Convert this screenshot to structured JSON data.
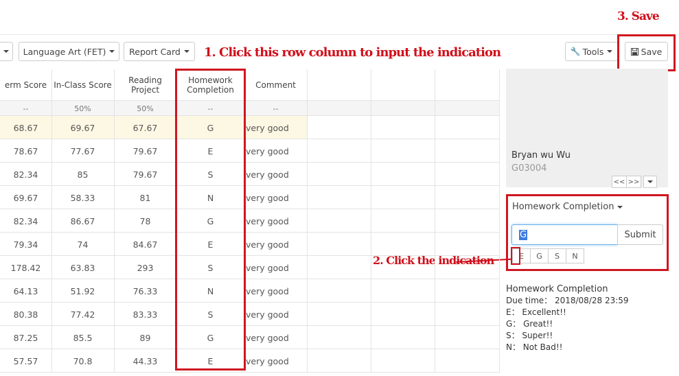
{
  "toolbar": {
    "prev_dropdown_label": "",
    "subject_label": "Language Art (FET)",
    "report_label": "Report Card",
    "tools_label": "Tools",
    "save_label": "Save"
  },
  "annotations": {
    "step1": "1. Click this row column to input the indication",
    "step2": "2. Click  the indication",
    "step3": "3. Save"
  },
  "table": {
    "headers": [
      "erm Score",
      "In-Class Score",
      "Reading Project",
      "Homework\nCompletion",
      "Comment",
      "",
      "",
      ""
    ],
    "weights": [
      "--",
      "50%",
      "50%",
      "--",
      "--",
      "",
      "",
      ""
    ],
    "rows": [
      [
        "68.67",
        "69.67",
        "67.67",
        "G",
        "very good"
      ],
      [
        "78.67",
        "77.67",
        "79.67",
        "E",
        "very good"
      ],
      [
        "82.34",
        "85",
        "79.67",
        "S",
        "very good"
      ],
      [
        "69.67",
        "58.33",
        "81",
        "N",
        "very good"
      ],
      [
        "82.34",
        "86.67",
        "78",
        "G",
        "very good"
      ],
      [
        "79.34",
        "74",
        "84.67",
        "E",
        "very good"
      ],
      [
        "178.42",
        "63.83",
        "293",
        "S",
        "very good"
      ],
      [
        "64.13",
        "51.92",
        "76.33",
        "N",
        "very good"
      ],
      [
        "80.38",
        "77.42",
        "83.33",
        "S",
        "very good"
      ],
      [
        "87.25",
        "85.5",
        "89",
        "G",
        "very good"
      ],
      [
        "57.57",
        "70.8",
        "44.33",
        "E",
        "very good"
      ]
    ]
  },
  "student": {
    "name": "Bryan wu Wu",
    "id": "G03004",
    "nav_prev": "<<",
    "nav_next": ">>"
  },
  "entry": {
    "title": "Homework Completion",
    "input_value": "G",
    "submit_label": "Submit",
    "options": [
      "E",
      "G",
      "S",
      "N"
    ]
  },
  "info": {
    "title": "Homework Completion",
    "due": "Due time： 2018/08/28 23:59",
    "legend": [
      "E： Excellent!!",
      "G： Great!!",
      "S： Super!!",
      "N： Not Bad!!"
    ]
  },
  "colors": {
    "annotation_red": "#d0101b",
    "highlight_row": "#fdf8e4",
    "input_border": "#66afe9"
  }
}
